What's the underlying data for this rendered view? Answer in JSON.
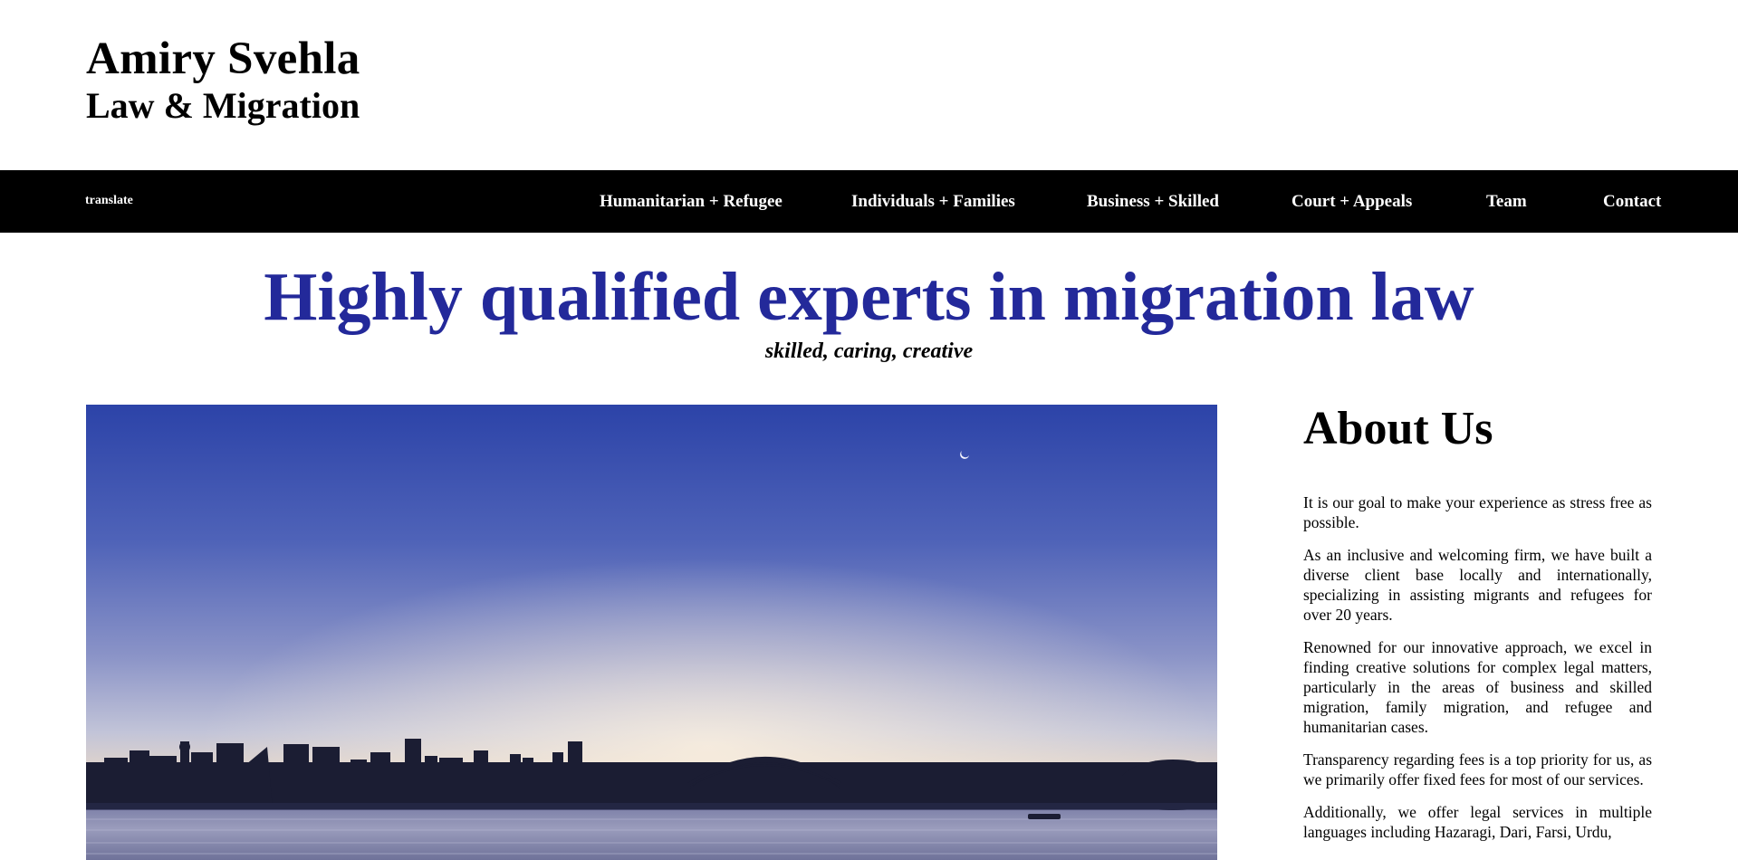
{
  "header": {
    "brand_line1": "Amiry Svehla",
    "brand_line2": "Law & Migration"
  },
  "nav": {
    "translate": "translate",
    "items": [
      {
        "label": "Humanitarian + Refugee"
      },
      {
        "label": "Individuals + Families"
      },
      {
        "label": "Business + Skilled"
      },
      {
        "label": "Court + Appeals"
      },
      {
        "label": "Team"
      },
      {
        "label": "Contact"
      }
    ]
  },
  "hero": {
    "title": "Highly qualified experts in migration law",
    "subtitle": "skilled, caring, creative",
    "image_icon": "sydney-harbour-skyline-photo"
  },
  "about": {
    "title": "About Us",
    "paragraphs": [
      "It is our goal to make your experience as stress free as possible.",
      "As an inclusive and welcoming firm, we have built a diverse client base locally and internationally, specializing in assisting migrants and refugees for over 20 years.",
      "Renowned for our innovative approach, we excel in finding creative solutions for complex legal matters, particularly in the areas of business and skilled migration, family migration, and refugee and humanitarian cases.",
      "Transparency regarding fees is a top priority for us, as we primarily offer fixed fees for most of our services.",
      "Additionally, we offer legal services in multiple languages including Hazaragi, Dari, Farsi, Urdu,"
    ]
  },
  "colors": {
    "accent": "#23299a",
    "nav_bg": "#000000",
    "nav_text": "#ffffff"
  }
}
